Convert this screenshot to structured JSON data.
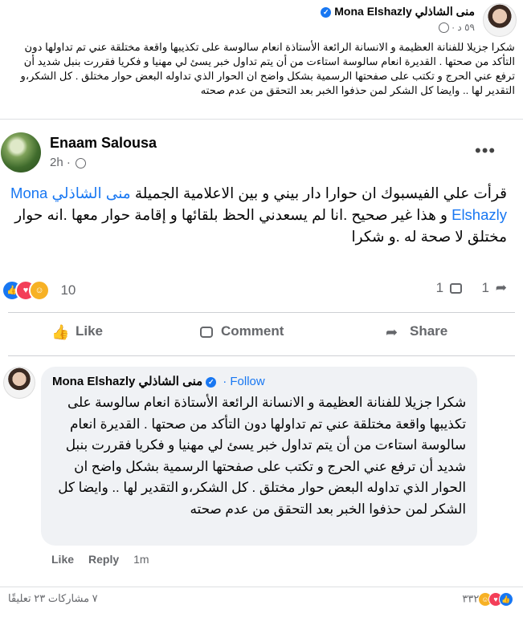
{
  "post": {
    "author": "Mona Elshazly منى الشاذلي",
    "meta": "٥٩ د ·",
    "body": "شكرا جزيلا للفنانة العظيمة و الانسانة الرائعة الأستاذة انعام سالوسة على تكذيبها واقعة مختلقة عني تم تداولها دون التأكد من صحتها . القديرة انعام سالوسة استاءت من أن يتم تداول خبر يسئ لي مهنيا و فكريا فقررت بنبل شديد أن ترفع عني الحرج و تكتب على صفحتها الرسمية بشكل واضح ان الحوار الذي تداوله البعض حوار مختلق . كل الشكر،و التقدير لها .. وايضا كل الشكر لمن حذفوا الخبر بعد التحقق من عدم صحته"
  },
  "shot": {
    "name": "Enaam Salousa",
    "time": "2h ·",
    "more": "•••",
    "text_intro": "قرأت علي الفيسبوك ان حوارا دار  بيني و بين الاعلامية الجميلة  ",
    "tag": "منى الشاذلي Mona Elshazly",
    "text_rest": " و هذا غير صحيح .انا لم يسعدني الحظ بلقائها  و إقامة حوار معها .انه حوار مختلق لا صحة له .و شكرا",
    "reaction_count": "10",
    "comment_count": "1",
    "share_count": "1",
    "like_label": "Like",
    "comment_label": "Comment",
    "share_label": "Share",
    "reply": {
      "name": "Mona Elshazly منى الشاذلي",
      "follow": "· Follow",
      "text": "شكرا جزيلا للفنانة العظيمة و الانسانة الرائعة الأستاذة انعام سالوسة على تكذيبها واقعة مختلقة عني تم تداولها دون التأكد من صحتها . القديرة انعام سالوسة استاءت من أن يتم تداول خبر يسئ لي مهنيا و فكريا فقررت بنبل شديد أن ترفع عني الحرج و تكتب على صفحتها الرسمية بشكل واضح ان الحوار الذي تداوله البعض حوار مختلق . كل الشكر،و التقدير لها .. وايضا كل الشكر لمن حذفوا الخبر بعد التحقق من عدم صحته",
      "like": "Like",
      "reply": "Reply",
      "time": "1m"
    }
  },
  "footer": {
    "reaction_count": "٣٣٢",
    "comments": "٢٣ تعليقًا",
    "shares": "٧ مشاركات"
  },
  "colors": {
    "accent": "#1877f2",
    "secondary_text": "#65676b",
    "bubble": "#f0f2f5"
  },
  "icons": [
    "verified-icon",
    "globe-icon",
    "more-icon",
    "like-icon",
    "comment-icon",
    "share-icon",
    "love-reaction-icon",
    "haha-reaction-icon",
    "care-reaction-icon"
  ]
}
